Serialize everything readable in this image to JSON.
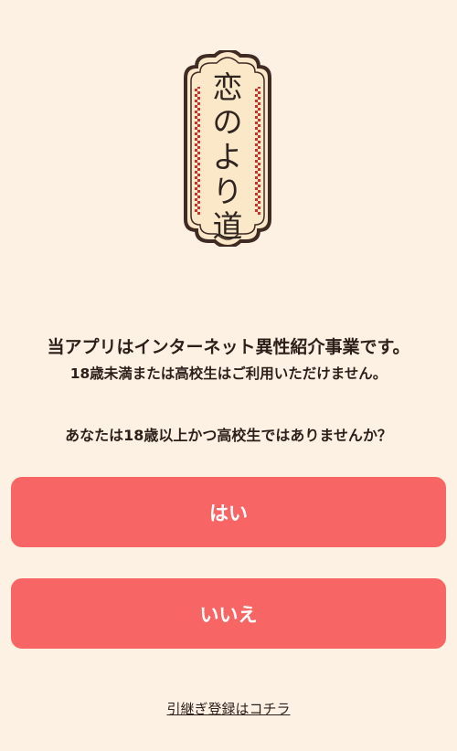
{
  "logo": {
    "text_lines": [
      "恋",
      "の",
      "よ",
      "り",
      "道"
    ],
    "colors": {
      "frame": "#3f2a24",
      "panel": "#fbe8c8",
      "checker": "#c8332d"
    }
  },
  "notice": {
    "main": "当アプリはインターネット異性紹介事業です。",
    "sub": "18歳未満または高校生はご利用いただけません。"
  },
  "question": "あなたは18歳以上かつ高校生ではありませんか？",
  "buttons": {
    "yes_label": "はい",
    "no_label": "いいえ",
    "color": "#f86565"
  },
  "transfer_link": "引継ぎ登録はコチラ",
  "colors": {
    "background": "#fdf1e3",
    "text": "#2b1f1a"
  }
}
